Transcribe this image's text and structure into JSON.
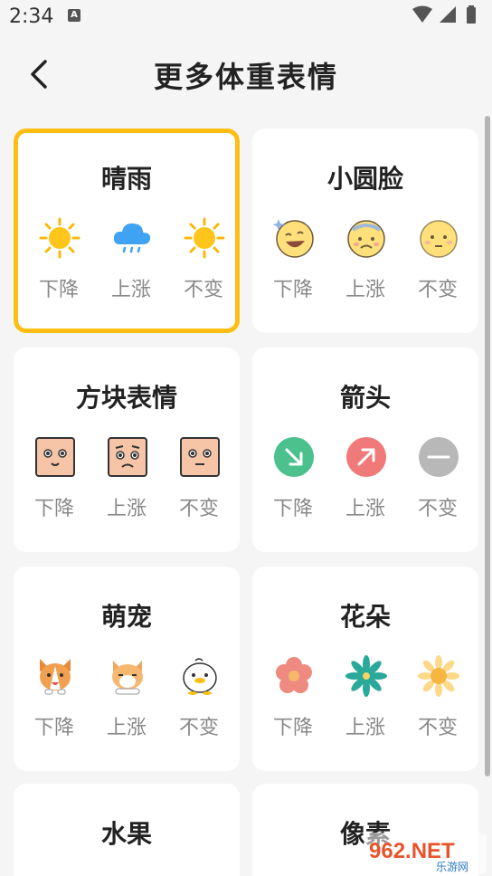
{
  "status": {
    "time": "2:34",
    "notif": "A"
  },
  "header": {
    "title": "更多体重表情"
  },
  "cards": [
    {
      "title": "晴雨",
      "selected": true,
      "items": [
        {
          "icon": "sun-icon",
          "label": "下降"
        },
        {
          "icon": "rain-cloud-icon",
          "label": "上涨"
        },
        {
          "icon": "sun-icon",
          "label": "不变"
        }
      ]
    },
    {
      "title": "小圆脸",
      "selected": false,
      "items": [
        {
          "icon": "laughing-face-icon",
          "label": "下降"
        },
        {
          "icon": "sad-face-icon",
          "label": "上涨"
        },
        {
          "icon": "neutral-face-icon",
          "label": "不变"
        }
      ]
    },
    {
      "title": "方块表情",
      "selected": false,
      "items": [
        {
          "icon": "square-smile-face-icon",
          "label": "下降"
        },
        {
          "icon": "square-worried-face-icon",
          "label": "上涨"
        },
        {
          "icon": "square-flat-face-icon",
          "label": "不变"
        }
      ]
    },
    {
      "title": "箭头",
      "selected": false,
      "items": [
        {
          "icon": "arrow-down-right-icon",
          "label": "下降"
        },
        {
          "icon": "arrow-up-right-icon",
          "label": "上涨"
        },
        {
          "icon": "minus-circle-icon",
          "label": "不变"
        }
      ]
    },
    {
      "title": "萌宠",
      "selected": false,
      "items": [
        {
          "icon": "corgi-icon",
          "label": "下降"
        },
        {
          "icon": "cat-icon",
          "label": "上涨"
        },
        {
          "icon": "duck-icon",
          "label": "不变"
        }
      ]
    },
    {
      "title": "花朵",
      "selected": false,
      "items": [
        {
          "icon": "pink-flower-icon",
          "label": "下降"
        },
        {
          "icon": "teal-flower-icon",
          "label": "上涨"
        },
        {
          "icon": "daisy-icon",
          "label": "不变"
        }
      ]
    },
    {
      "title": "水果",
      "selected": false,
      "items": []
    },
    {
      "title": "像素",
      "selected": false,
      "items": []
    }
  ],
  "colors": {
    "accent": "#FDBE14",
    "down": "#4CC08D",
    "up": "#F07A7A",
    "neutral": "#B8B8B8"
  },
  "watermark": {
    "text": "962.NET",
    "sub": "乐游网"
  }
}
